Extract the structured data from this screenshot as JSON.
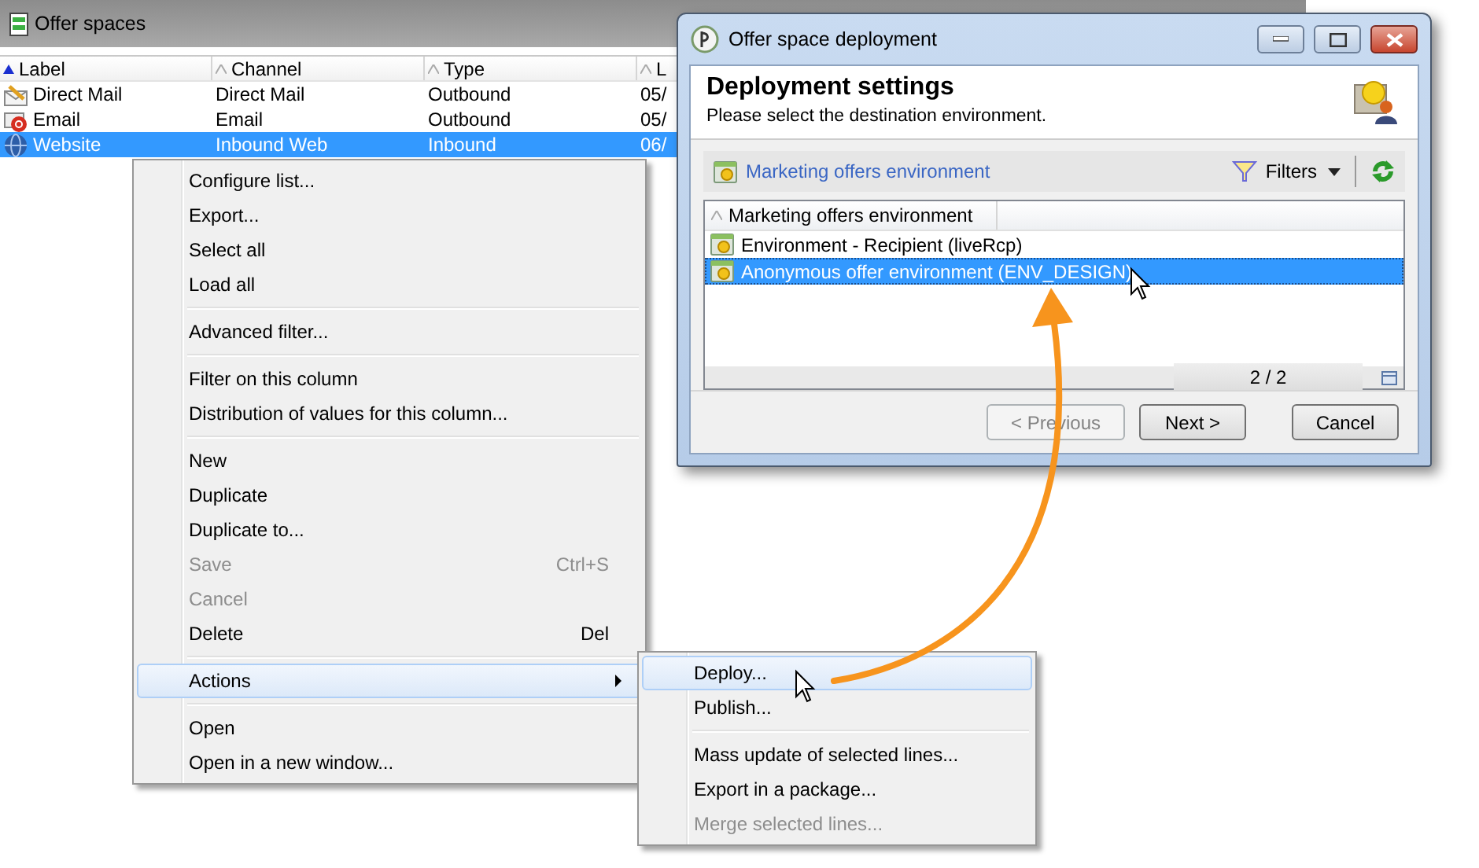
{
  "main_window": {
    "title": "Offer spaces",
    "columns": [
      {
        "label": "Label",
        "sorted": true
      },
      {
        "label": "Channel",
        "sorted": false
      },
      {
        "label": "Type",
        "sorted": false
      },
      {
        "label": "L",
        "sorted": false
      }
    ],
    "rows": [
      {
        "kind": "mail",
        "cells": [
          "Direct Mail",
          "Direct Mail",
          "Outbound",
          "05/"
        ],
        "selected": false
      },
      {
        "kind": "email",
        "cells": [
          "Email",
          "Email",
          "Outbound",
          "05/"
        ],
        "selected": false
      },
      {
        "kind": "web",
        "cells": [
          "Website",
          "Inbound Web",
          "Inbound",
          "06/"
        ],
        "selected": true
      }
    ]
  },
  "context_menu": {
    "sections": [
      [
        {
          "label": "Configure list...",
          "disabled": false,
          "selected": false
        },
        {
          "label": "Export...",
          "disabled": false,
          "selected": false
        },
        {
          "label": "Select all",
          "disabled": false,
          "selected": false
        },
        {
          "label": "Load all",
          "disabled": false,
          "selected": false
        }
      ],
      [
        {
          "label": "Advanced filter...",
          "disabled": false,
          "selected": false
        }
      ],
      [
        {
          "label": "Filter on this column",
          "disabled": false,
          "selected": false
        },
        {
          "label": "Distribution of values for this column...",
          "disabled": false,
          "selected": false
        }
      ],
      [
        {
          "label": "New",
          "disabled": false,
          "selected": false
        },
        {
          "label": "Duplicate",
          "disabled": false,
          "selected": false
        },
        {
          "label": "Duplicate to...",
          "disabled": false,
          "selected": false
        },
        {
          "label": "Save",
          "shortcut": "Ctrl+S",
          "disabled": true,
          "selected": false
        },
        {
          "label": "Cancel",
          "disabled": true,
          "selected": false
        },
        {
          "label": "Delete",
          "shortcut": "Del",
          "disabled": false,
          "selected": false
        }
      ],
      [
        {
          "label": "Actions",
          "disabled": false,
          "selected": true,
          "has_submenu": true
        }
      ],
      [
        {
          "label": "Open",
          "disabled": false,
          "selected": false
        },
        {
          "label": "Open in a new window...",
          "disabled": false,
          "selected": false
        }
      ]
    ]
  },
  "submenu": {
    "sections": [
      [
        {
          "label": "Deploy...",
          "disabled": false,
          "selected": true
        },
        {
          "label": "Publish...",
          "disabled": false,
          "selected": false
        }
      ],
      [
        {
          "label": "Mass update of selected lines...",
          "disabled": false,
          "selected": false
        },
        {
          "label": "Export in a package...",
          "disabled": false,
          "selected": false
        },
        {
          "label": "Merge selected lines...",
          "disabled": true,
          "selected": false
        }
      ]
    ]
  },
  "dialog": {
    "title": "Offer space deployment",
    "heading": "Deployment settings",
    "subheading": "Please select the destination environment.",
    "toolbar": {
      "link": "Marketing offers environment",
      "filters": "Filters"
    },
    "list": {
      "column": {
        "label": "Marketing offers environment",
        "sorted": false
      },
      "rows": [
        {
          "label": "Environment - Recipient (liveRcp)",
          "selected": false
        },
        {
          "label": "Anonymous offer environment (ENV_DESIGN)",
          "selected": true
        }
      ],
      "count": "2 / 2"
    },
    "buttons": [
      {
        "label": "< Previous",
        "disabled": true
      },
      {
        "label": "Next >",
        "disabled": false
      },
      {
        "label": "Cancel",
        "disabled": false
      }
    ]
  }
}
